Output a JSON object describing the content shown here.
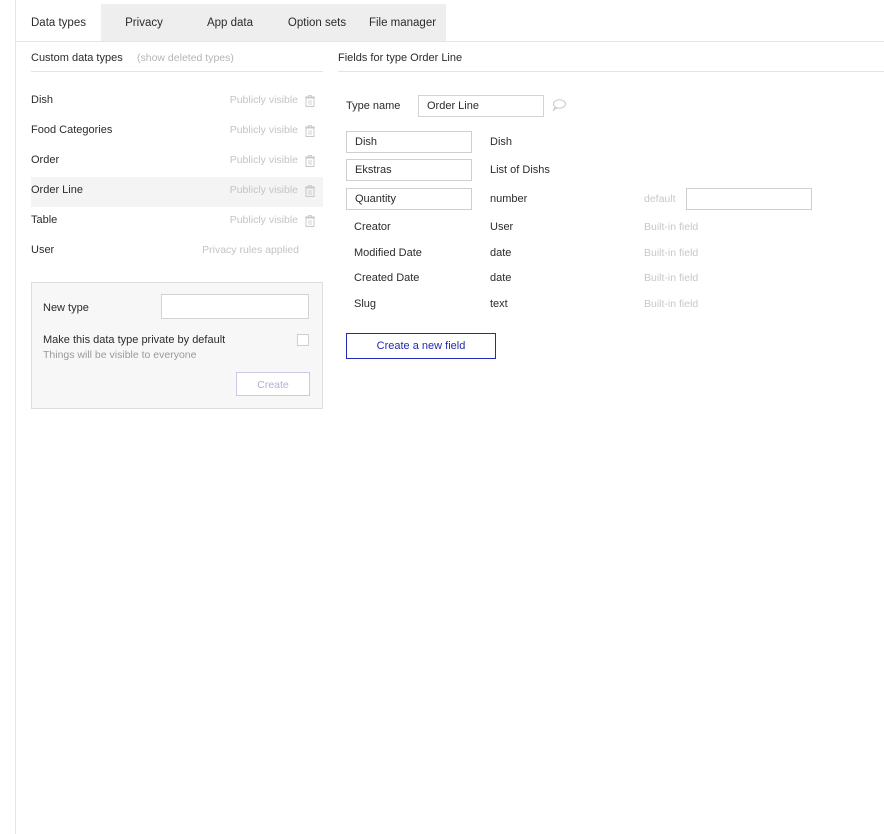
{
  "tabs": [
    "Data types",
    "Privacy",
    "App data",
    "Option sets",
    "File manager"
  ],
  "left": {
    "title": "Custom data types",
    "show_deleted": "(show deleted types)",
    "types": [
      {
        "name": "Dish",
        "visibility": "Publicly visible"
      },
      {
        "name": "Food Categories",
        "visibility": "Publicly visible"
      },
      {
        "name": "Order",
        "visibility": "Publicly visible"
      },
      {
        "name": "Order Line",
        "visibility": "Publicly visible"
      },
      {
        "name": "Table",
        "visibility": "Publicly visible"
      },
      {
        "name": "User",
        "visibility": "Privacy rules applied"
      }
    ],
    "new_type": {
      "label": "New type",
      "private_label": "Make this data type private by default",
      "private_sub": "Things will be visible to everyone",
      "create_label": "Create"
    }
  },
  "right": {
    "title": "Fields for type Order Line",
    "type_name_label": "Type name",
    "type_name_value": "Order Line",
    "custom_fields": [
      {
        "name": "Dish",
        "type": "Dish"
      },
      {
        "name": "Ekstras",
        "type": "List of Dishs"
      },
      {
        "name": "Quantity",
        "type": "number",
        "default_label": "default"
      }
    ],
    "builtin_fields": [
      {
        "name": "Creator",
        "type": "User",
        "note": "Built-in field"
      },
      {
        "name": "Modified Date",
        "type": "date",
        "note": "Built-in field"
      },
      {
        "name": "Created Date",
        "type": "date",
        "note": "Built-in field"
      },
      {
        "name": "Slug",
        "type": "text",
        "note": "Built-in field"
      }
    ],
    "create_field_label": "Create a new field"
  },
  "colors": {
    "accent": "#1f2bb0",
    "selected_row": "#f4f4f4",
    "tab_bar": "#eeeeee"
  }
}
